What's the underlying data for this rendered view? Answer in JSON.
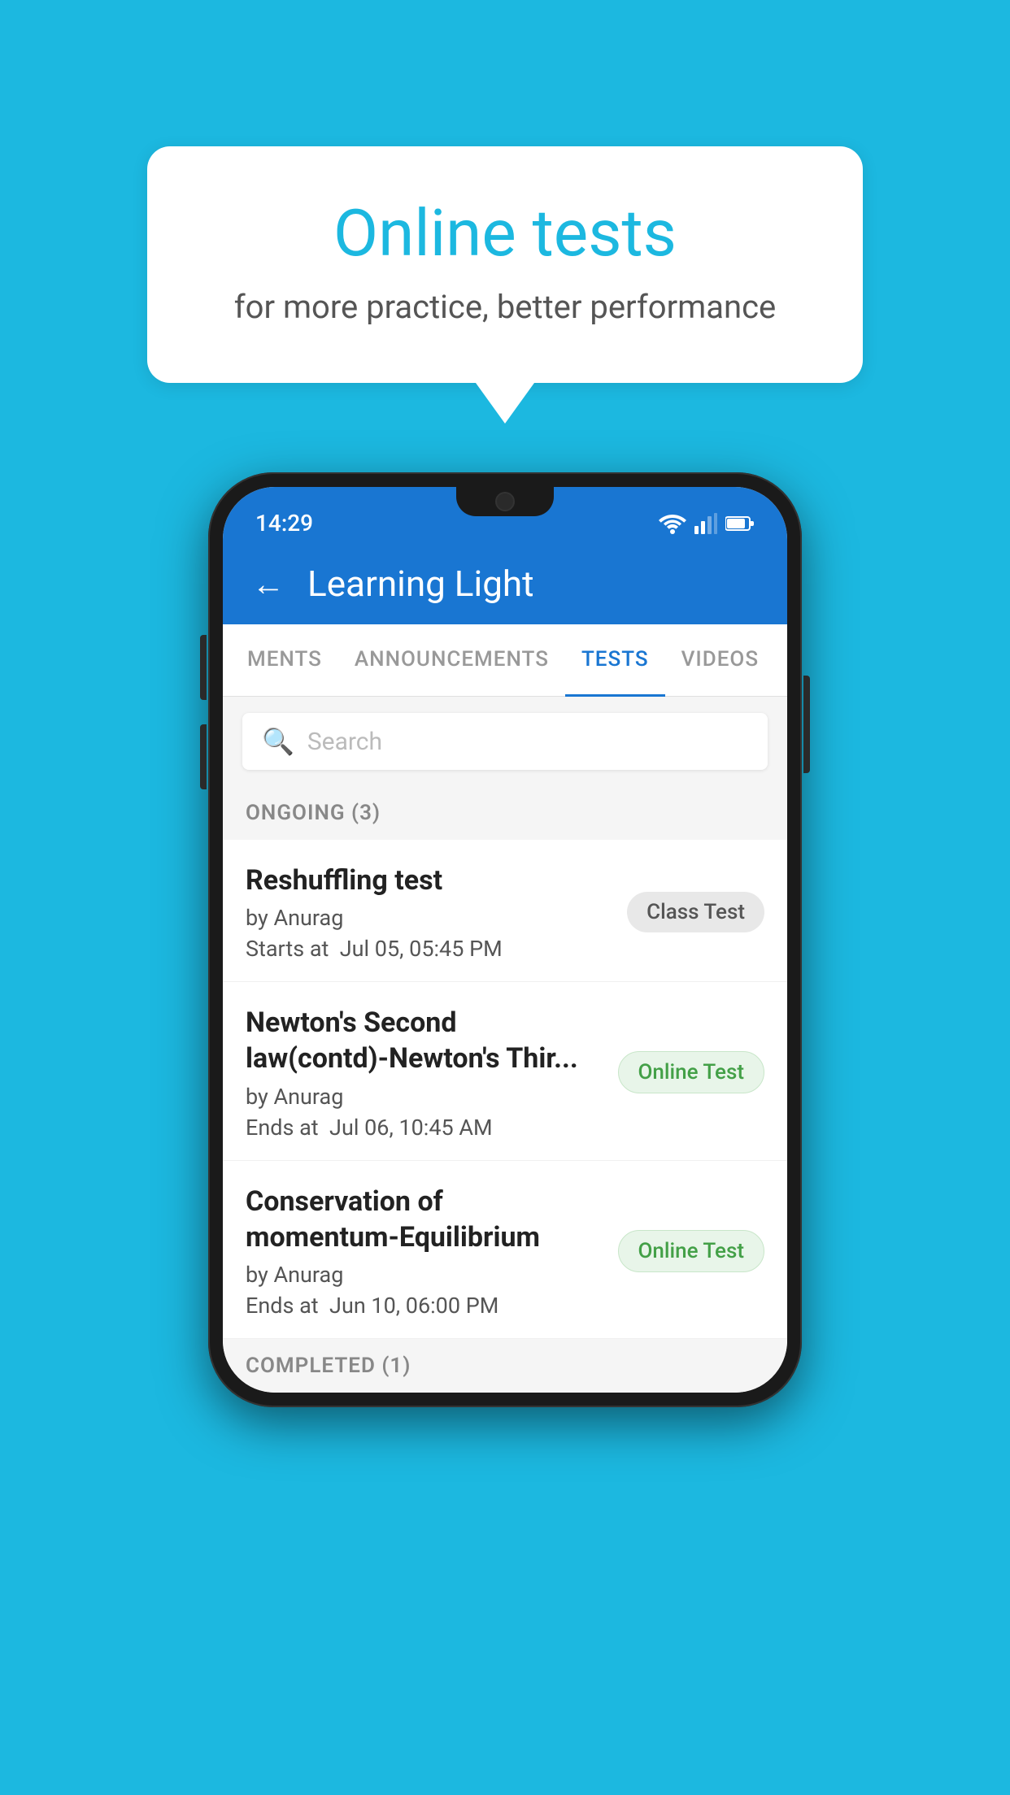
{
  "background": {
    "color": "#1cb8e0"
  },
  "speech_bubble": {
    "title": "Online tests",
    "subtitle": "for more practice, better performance"
  },
  "phone": {
    "status_bar": {
      "time": "14:29"
    },
    "header": {
      "title": "Learning Light"
    },
    "tabs": [
      {
        "label": "MENTS",
        "active": false
      },
      {
        "label": "ANNOUNCEMENTS",
        "active": false
      },
      {
        "label": "TESTS",
        "active": true
      },
      {
        "label": "VIDEOS",
        "active": false
      }
    ],
    "search": {
      "placeholder": "Search"
    },
    "ongoing_section": {
      "label": "ONGOING (3)"
    },
    "tests": [
      {
        "name": "Reshuffling test",
        "author": "by Anurag",
        "time_label": "Starts at",
        "time": "Jul 05, 05:45 PM",
        "badge": "Class Test",
        "badge_type": "class"
      },
      {
        "name": "Newton's Second law(contd)-Newton's Thir...",
        "author": "by Anurag",
        "time_label": "Ends at",
        "time": "Jul 06, 10:45 AM",
        "badge": "Online Test",
        "badge_type": "online"
      },
      {
        "name": "Conservation of momentum-Equilibrium",
        "author": "by Anurag",
        "time_label": "Ends at",
        "time": "Jun 10, 06:00 PM",
        "badge": "Online Test",
        "badge_type": "online"
      }
    ],
    "completed_section": {
      "label": "COMPLETED (1)"
    }
  }
}
